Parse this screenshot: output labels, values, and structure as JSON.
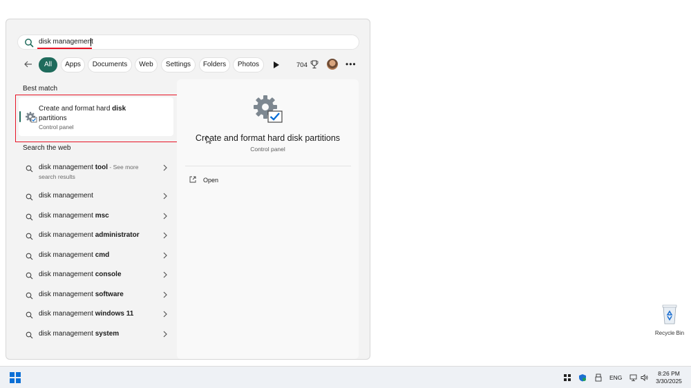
{
  "search": {
    "query": "disk management"
  },
  "filters": {
    "chips": [
      "All",
      "Apps",
      "Documents",
      "Web",
      "Settings",
      "Folders",
      "Photos"
    ],
    "active": "All",
    "points": "704"
  },
  "best_match": {
    "heading": "Best match",
    "title_part1": "Create and format hard ",
    "title_bold": "disk",
    "title_part2": "partitions",
    "subtitle": "Control panel"
  },
  "search_web": {
    "heading": "Search the web",
    "items": [
      {
        "prefix": "disk management ",
        "bold": "tool",
        "extra": " - See more",
        "extra2": "search results"
      },
      {
        "prefix": "disk management",
        "bold": ""
      },
      {
        "prefix": "disk management ",
        "bold": "msc"
      },
      {
        "prefix": "disk management ",
        "bold": "administrator"
      },
      {
        "prefix": "disk management ",
        "bold": "cmd"
      },
      {
        "prefix": "disk management ",
        "bold": "console"
      },
      {
        "prefix": "disk management ",
        "bold": "software"
      },
      {
        "prefix": "disk management ",
        "bold": "windows 11"
      },
      {
        "prefix": "disk management ",
        "bold": "system"
      }
    ]
  },
  "preview": {
    "title": "Create and format hard disk partitions",
    "subtitle": "Control panel",
    "open_label": "Open"
  },
  "desktop": {
    "recycle_bin": "Recycle Bin"
  },
  "taskbar": {
    "language": "ENG",
    "time": "8:26 PM",
    "date": "3/30/2025"
  },
  "colors": {
    "accent": "#1f6b5c",
    "highlight": "#e81123",
    "start": "#0b6fd6"
  }
}
